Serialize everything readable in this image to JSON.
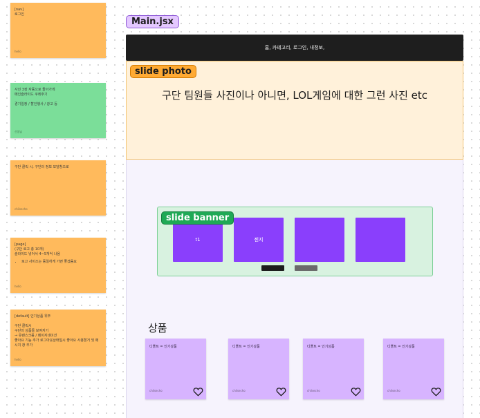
{
  "sticky_notes": [
    {
      "text": "[nav]\n로그인",
      "author": "hello",
      "color": "#ffba5c"
    },
    {
      "text": "사진 3장 자동으로 돌아가게\n메인슬라이드 쿠레주기\n\n경기일정 / 할인행사 / 광고 등",
      "author": "선생님",
      "color": "#7bde99"
    },
    {
      "text": "구단 클릭 시, 구단의 정보 모달창으로",
      "author": "chilsecho",
      "color": "#ffba5c"
    },
    {
      "text": "[page]\n(구단 로고 총 10개)\n슬라이드 넣어서 4~5개씩 나옴",
      "bullets": [
        "로고 사이즈는 동일하게 가면 좋겠음요"
      ],
      "author": "hello",
      "color": "#ffba5c"
    },
    {
      "text": "[default] 인기상품 위주\n\n구단 클릭시\n구단의 상품들 보여지기\n→ 유랜스크롤 / 페이지네이션\n좋아요 기능 추가 로그아웃상태일시 좋아요 사용할거 및 메시지 창 추가",
      "author": "hello",
      "color": "#ffba5c"
    }
  ],
  "frame": {
    "title": "Main.jsx"
  },
  "navbar": {
    "text": "홈, 카테고리, 로그인, 내정보,"
  },
  "photo": {
    "tag": "slide photo",
    "text": "구단 팀원들 사진이나 아니면, LOL게임에 대한 그런 사진 etc"
  },
  "banner": {
    "tag": "slide banner",
    "slides": [
      "t1",
      "젠지",
      "",
      ""
    ],
    "indicator_colors": [
      "#1c1c1c",
      "#6a6a6a"
    ]
  },
  "products": {
    "title": "상품",
    "items": [
      {
        "label": "디폴트 = 인기상품",
        "author": "chilsecho"
      },
      {
        "label": "디폴트 = 인기상품",
        "author": "chilsecho"
      },
      {
        "label": "디폴트 = 인기상품",
        "author": "chilsecho"
      },
      {
        "label": "디폴트 = 인기상품",
        "author": "chilsecho"
      }
    ]
  },
  "icons": {
    "product_like": "heart-outline-icon"
  },
  "colors": {
    "frame_label": "#e4c8ff",
    "navbar": "#1e1e1e",
    "photo_box": "#fff1da",
    "photo_tag": "#ffaa33",
    "banner_box": "#d8f2e0",
    "banner_tag": "#1fa955",
    "banner_slide": "#8a3ffc",
    "product_card": "#d7b4ff"
  }
}
